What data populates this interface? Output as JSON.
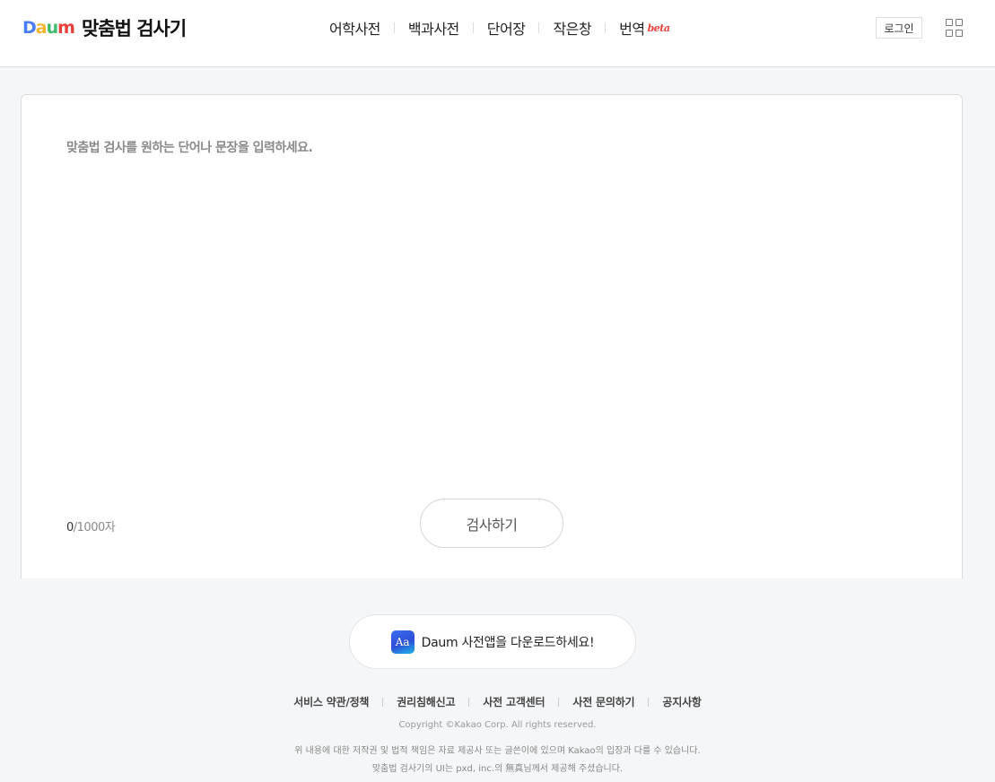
{
  "header": {
    "logo_letters": [
      "D",
      "a",
      "u",
      "m"
    ],
    "logo_colors": [
      "#4a7cf6",
      "#f2b52d",
      "#3dbb6a",
      "#e8403b"
    ],
    "title": "맞춤법 검사기",
    "nav": [
      {
        "label": "어학사전"
      },
      {
        "label": "백과사전"
      },
      {
        "label": "단어장"
      },
      {
        "label": "작은창"
      },
      {
        "label": "번역",
        "badge": "beta"
      }
    ],
    "login_label": "로그인",
    "apps_icon": "grid-apps-icon"
  },
  "editor": {
    "placeholder": "맞춤법 검사를 원하는 단어나 문장을 입력하세요.",
    "value": "",
    "count_current": "0",
    "count_max": "/1000자",
    "submit_label": "검사하기"
  },
  "footer": {
    "app_banner_text": "Daum 사전앱을 다운로드하세요!",
    "app_icon_glyph": "Aa",
    "links": [
      "서비스 약관/정책",
      "권리침해신고",
      "사전 고객센터",
      "사전 문의하기",
      "공지사항"
    ],
    "copyright": "Copyright ©Kakao Corp. All rights reserved.",
    "notice_line1": "위 내용에 대한 저작권 및 법적 책임은 자료 제공사 또는 글쓴이에 있으며 Kakao의 입장과 다를 수 있습니다.",
    "notice_line2": "맞춤법 검사기의 UI는 pxd, inc.의 無真님께서 제공해 주셨습니다."
  },
  "colors": {
    "accent_beta": "#e8403b",
    "page_bg": "#f5f6f7"
  }
}
